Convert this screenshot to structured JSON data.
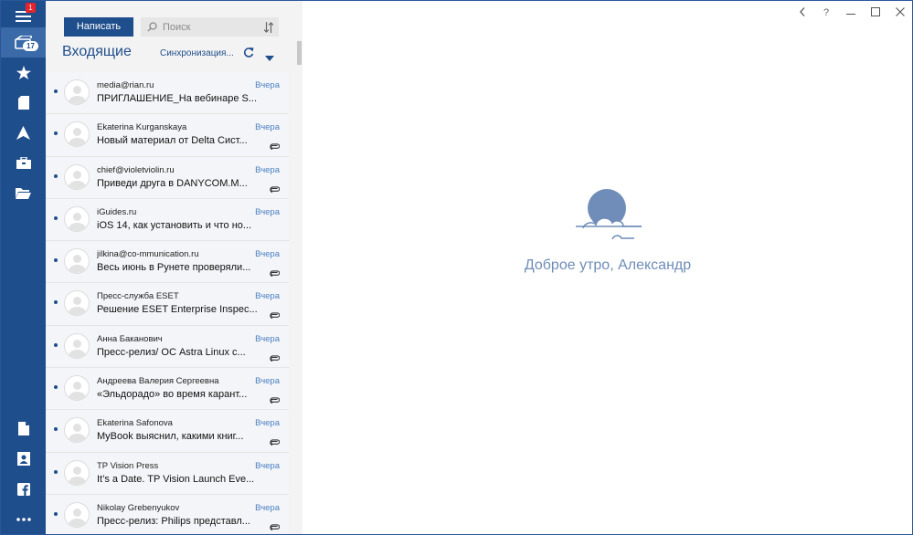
{
  "rail": {
    "menu_badge": "1",
    "inbox_count": "17",
    "items": [
      {
        "name": "menu-button",
        "icon": "hamburger-icon"
      },
      {
        "name": "mail-button",
        "icon": "mail-icon"
      },
      {
        "name": "favorites-button",
        "icon": "star-icon"
      },
      {
        "name": "drafts-button",
        "icon": "page-icon"
      },
      {
        "name": "sent-button",
        "icon": "send-arrow-icon"
      },
      {
        "name": "archive-button",
        "icon": "briefcase-icon"
      },
      {
        "name": "folders-button",
        "icon": "folder-icon"
      },
      {
        "name": "notes-button",
        "icon": "document-icon"
      },
      {
        "name": "contacts-button",
        "icon": "contact-card-icon"
      },
      {
        "name": "facebook-button",
        "icon": "facebook-icon"
      },
      {
        "name": "more-button",
        "icon": "ellipsis-icon"
      }
    ]
  },
  "toolbar": {
    "compose_label": "Написать",
    "search_placeholder": "Поиск"
  },
  "folder": {
    "title": "Входящие",
    "sync_label": "Синхронизация..."
  },
  "messages": [
    {
      "sender": "media@rian.ru",
      "date": "Вчера",
      "subject": "ПРИГЛАШЕНИЕ_На вебинаре S...",
      "attachment": false
    },
    {
      "sender": "Ekaterina Kurganskaya",
      "date": "Вчера",
      "subject": "Новый материал от Delta Сист...",
      "attachment": true
    },
    {
      "sender": "chief@violetviolin.ru",
      "date": "Вчера",
      "subject": "Приведи друга в DANYCOM.M...",
      "attachment": true
    },
    {
      "sender": "iGuides.ru",
      "date": "Вчера",
      "subject": "iOS 14, как установить и что но...",
      "attachment": false
    },
    {
      "sender": "jilkina@co-mmunication.ru",
      "date": "Вчера",
      "subject": "Весь июнь в Рунете проверяли...",
      "attachment": true
    },
    {
      "sender": "Пресс-служба ESET",
      "date": "Вчера",
      "subject": "Решение ESET Enterprise Inspec...",
      "attachment": true
    },
    {
      "sender": "Анна Баканович",
      "date": "Вчера",
      "subject": "Пресс-релиз/ ОС Astra Linux с...",
      "attachment": true
    },
    {
      "sender": "Андреева Валерия Сергеевна",
      "date": "Вчера",
      "subject": "«Эльдорадо» во время карант...",
      "attachment": true
    },
    {
      "sender": "Ekaterina Safonova",
      "date": "Вчера",
      "subject": "MyBook выяснил, какими книг...",
      "attachment": true
    },
    {
      "sender": "TP Vision Press",
      "date": "Вчера",
      "subject": "It’s a Date. TP Vision Launch Eve...",
      "attachment": false
    },
    {
      "sender": "Nikolay Grebenyukov",
      "date": "Вчера",
      "subject": "Пресс-релиз: Philips представл...",
      "attachment": true
    }
  ],
  "reading_pane": {
    "greeting": "Доброе утро, Александр"
  },
  "window": {
    "help_label": "?"
  },
  "colors": {
    "rail": "#1f4e8c",
    "accent": "#1f4e8c",
    "date": "#4a7fc1",
    "greeting": "#6f8db8"
  }
}
